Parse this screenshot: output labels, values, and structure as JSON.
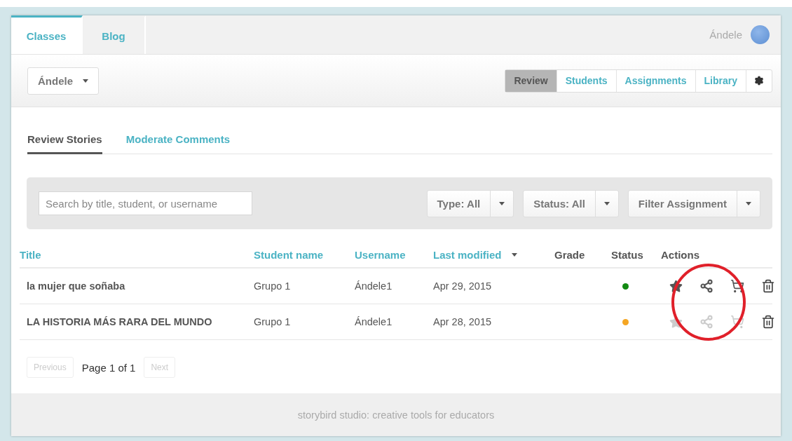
{
  "top_tabs": [
    {
      "label": "Classes",
      "selected": true
    },
    {
      "label": "Blog",
      "selected": false
    }
  ],
  "user": {
    "name": "Ándele"
  },
  "class_select": {
    "value": "Ándele"
  },
  "nav": [
    {
      "label": "Review",
      "selected": true
    },
    {
      "label": "Students",
      "selected": false
    },
    {
      "label": "Assignments",
      "selected": false
    },
    {
      "label": "Library",
      "selected": false
    }
  ],
  "sub_tabs": [
    {
      "label": "Review Stories",
      "selected": true
    },
    {
      "label": "Moderate Comments",
      "selected": false
    }
  ],
  "search": {
    "placeholder": "Search by title, student, or username"
  },
  "filters": [
    {
      "label": "Type: All"
    },
    {
      "label": "Status: All"
    },
    {
      "label": "Filter Assignment"
    }
  ],
  "table": {
    "columns": [
      {
        "label": "Title",
        "sortable": true,
        "sorted": false
      },
      {
        "label": "Student name",
        "sortable": true,
        "sorted": false
      },
      {
        "label": "Username",
        "sortable": true,
        "sorted": false
      },
      {
        "label": "Last modified",
        "sortable": true,
        "sorted": true
      },
      {
        "label": "Grade",
        "sortable": false,
        "sorted": false
      },
      {
        "label": "Status",
        "sortable": false,
        "sorted": false
      },
      {
        "label": "Actions",
        "sortable": false,
        "sorted": false
      }
    ],
    "rows": [
      {
        "title": "la mujer que soñaba",
        "student": "Grupo 1",
        "username": "Ándele1",
        "modified": "Apr 29, 2015",
        "color": "#138a13",
        "actions_enabled": true
      },
      {
        "title": "LA HISTORIA MÁS RARA DEL MUNDO",
        "student": "Grupo 1",
        "username": "Ándele1",
        "modified": "Apr 28, 2015",
        "color": "#f5a623",
        "actions_enabled": false
      }
    ]
  },
  "pagination": {
    "previous": {
      "label": "Previous",
      "disabled": true
    },
    "page": "Page 1 of 1",
    "next": {
      "label": "Next",
      "disabled": true
    }
  },
  "footer": "storybird studio: creative tools for educators"
}
